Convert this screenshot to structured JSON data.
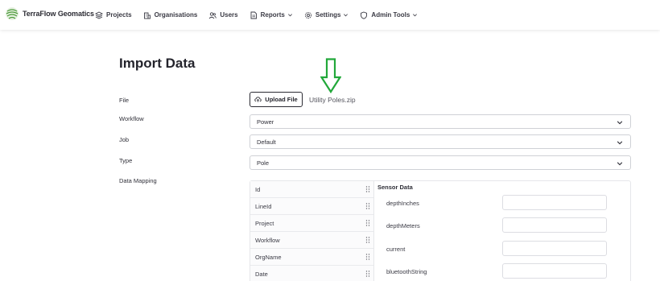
{
  "brand": {
    "name": "TerraFlow Geomatics"
  },
  "nav": {
    "projects": "Projects",
    "organisations": "Organisations",
    "users": "Users",
    "reports": "Reports",
    "settings": "Settings",
    "admin_tools": "Admin Tools"
  },
  "page": {
    "title": "Import Data"
  },
  "form": {
    "file_label": "File",
    "upload_button": "Upload File",
    "file_name": "Utility Poles.zip",
    "workflow_label": "Workflow",
    "workflow_value": "Power",
    "job_label": "Job",
    "job_value": "Default",
    "type_label": "Type",
    "type_value": "Pole",
    "mapping_label": "Data Mapping"
  },
  "mapping": {
    "fields": [
      "Id",
      "LineId",
      "Project",
      "Workflow",
      "OrgName",
      "Date"
    ],
    "sensor_title": "Sensor Data",
    "sensor_fields": [
      "depthInches",
      "depthMeters",
      "current",
      "bluetoothString"
    ]
  },
  "colors": {
    "annotation_arrow": "#22a83a",
    "brand_green": "#4c9a3a"
  },
  "icons": {
    "projects": "layers-icon",
    "organisations": "building-icon",
    "users": "users-icon",
    "reports": "document-icon",
    "settings": "gear-icon",
    "admin_tools": "shield-icon",
    "upload": "cloud-upload-icon",
    "drag": "drag-handle-icon",
    "dropdown": "chevron-down-icon"
  }
}
